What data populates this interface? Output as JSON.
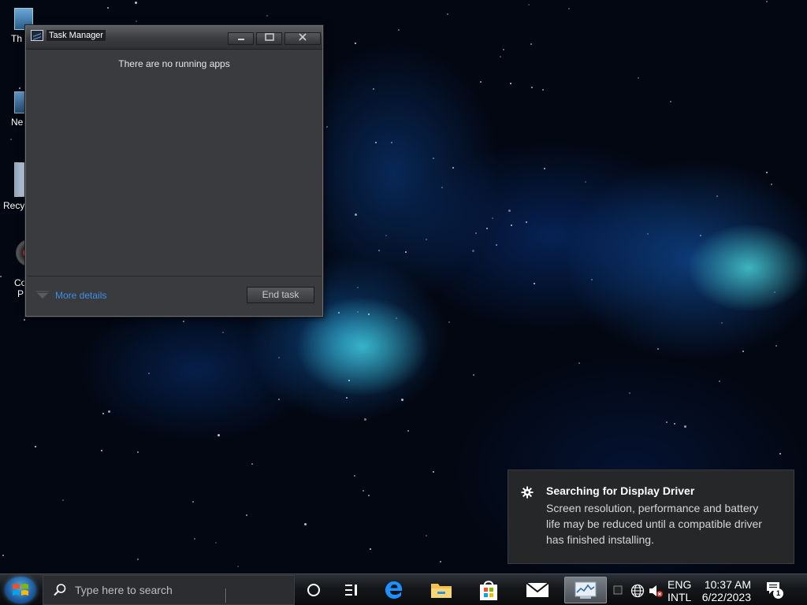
{
  "desktop": {
    "icons": [
      {
        "label": "Th"
      },
      {
        "label": "Ne"
      },
      {
        "label": "Recy"
      },
      {
        "label": "Co"
      },
      {
        "label": "P"
      }
    ]
  },
  "task_manager": {
    "title": "Task Manager",
    "empty_message": "There are no running apps",
    "more_details_label": "More details",
    "end_task_label": "End task"
  },
  "notification": {
    "title": "Searching for Display Driver",
    "body": "Screen resolution, performance and battery life may be reduced until a compatible driver has finished installing."
  },
  "taskbar": {
    "search_placeholder": "Type here to search",
    "language_primary": "ENG",
    "language_secondary": "INTL",
    "time": "10:37 AM",
    "date": "6/22/2023",
    "notification_count": "1"
  },
  "colors": {
    "link": "#3d8fe6",
    "window_bg": "#3a3b3e",
    "toast_bg": "#262729"
  }
}
